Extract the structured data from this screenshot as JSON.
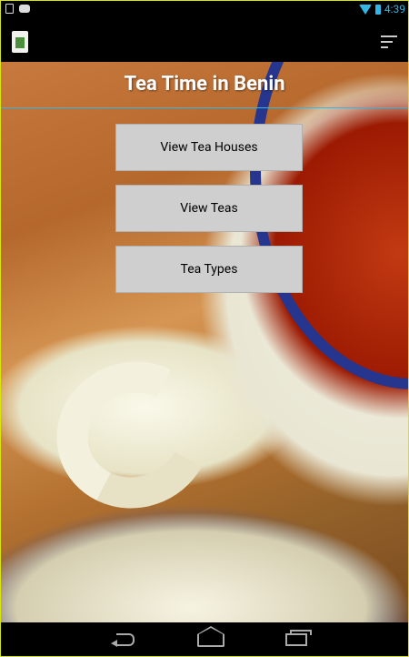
{
  "status_bar": {
    "time": "4:39"
  },
  "app": {
    "title": "Tea Time in Benin"
  },
  "menu": {
    "buttons": [
      {
        "label": "View Tea Houses"
      },
      {
        "label": "View Teas"
      },
      {
        "label": "Tea Types"
      }
    ]
  },
  "icons": {
    "status": [
      "notification-square-icon",
      "game-controller-icon",
      "wifi-icon",
      "battery-icon"
    ],
    "action_bar": [
      "app-logo-icon",
      "overflow-menu-icon"
    ],
    "navigation": [
      "back-icon",
      "home-icon",
      "recent-apps-icon"
    ]
  },
  "colors": {
    "accent": "#33b5e5",
    "button_bg": "#cfcfcf",
    "title_text": "#ffffff"
  }
}
